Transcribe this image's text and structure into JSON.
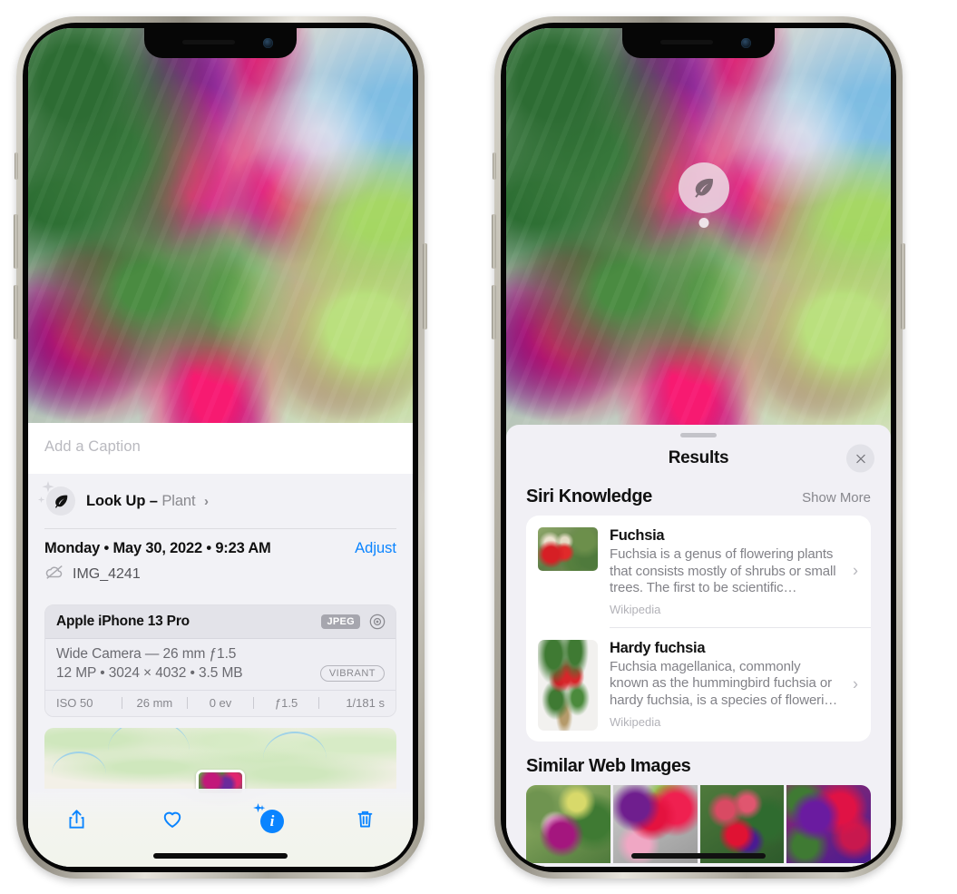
{
  "left_phone": {
    "caption": {
      "placeholder": "Add a Caption",
      "value": ""
    },
    "lookup": {
      "label": "Look Up –",
      "subject": "Plant",
      "chevron": "›",
      "icon": "leaf-icon"
    },
    "datetime": {
      "text": "Monday • May 30, 2022 • 9:23 AM",
      "adjust_label": "Adjust"
    },
    "file": {
      "name": "IMG_4241",
      "icon": "icloud-slash-icon"
    },
    "exif": {
      "device": "Apple iPhone 13 Pro",
      "format_badge": "JPEG",
      "aperture_icon": "aperture-icon",
      "lens": "Wide Camera — 26 mm ƒ1.5",
      "size_line": "12 MP • 3024 × 4032 • 3.5 MB",
      "style_badge": "VIBRANT",
      "stats": [
        "ISO 50",
        "26 mm",
        "0 ev",
        "ƒ1.5",
        "1/181 s"
      ]
    },
    "toolbar": [
      {
        "name": "share-button",
        "icon": "share-icon"
      },
      {
        "name": "favorite-button",
        "icon": "heart-icon"
      },
      {
        "name": "info-button",
        "icon": "info-sparkle-icon"
      },
      {
        "name": "delete-button",
        "icon": "trash-icon"
      }
    ]
  },
  "right_phone": {
    "badge": {
      "icon": "leaf-icon"
    },
    "sheet": {
      "title": "Results",
      "close_icon": "close-icon",
      "siri_knowledge": {
        "title": "Siri Knowledge",
        "action": "Show More",
        "items": [
          {
            "title": "Fuchsia",
            "description": "Fuchsia is a genus of flowering plants that consists mostly of shrubs or small trees. The first to be scientific…",
            "source": "Wikipedia",
            "chevron": "›"
          },
          {
            "title": "Hardy fuchsia",
            "description": "Fuchsia magellanica, commonly known as the hummingbird fuchsia or hardy fuchsia, is a species of floweri…",
            "source": "Wikipedia",
            "chevron": "›"
          }
        ]
      },
      "similar_web_images": {
        "title": "Similar Web Images",
        "thumbnails": [
          "fuchsia-web-1",
          "fuchsia-web-2",
          "fuchsia-web-3",
          "fuchsia-web-4"
        ]
      }
    }
  },
  "colors": {
    "accent_blue": "#0a84ff",
    "sheet_background": "#f1f0f5",
    "panel_background": "#f2f2f6",
    "card_background": "#ffffff",
    "secondary_text": "#8a8a8f"
  }
}
